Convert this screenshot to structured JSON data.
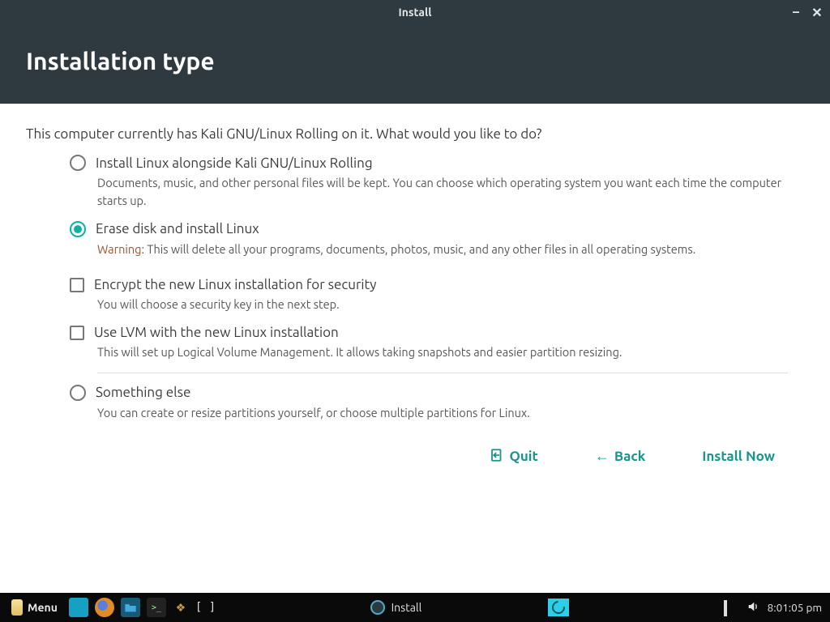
{
  "window": {
    "title": "Install"
  },
  "header": {
    "title": "Installation type"
  },
  "intro": "This computer currently has Kali GNU/Linux Rolling on it. What would you like to do?",
  "options": {
    "alongside": {
      "label": "Install Linux alongside Kali GNU/Linux Rolling",
      "desc": "Documents, music, and other personal files will be kept. You can choose which operating system you want each time the computer starts up."
    },
    "erase": {
      "label": "Erase disk and install Linux",
      "warn_label": "Warning:",
      "desc": " This will delete all your programs, documents, photos, music, and any other files in all operating systems."
    },
    "encrypt": {
      "label": "Encrypt the new Linux installation for security",
      "desc": "You will choose a security key in the next step."
    },
    "lvm": {
      "label": "Use LVM with the new Linux installation",
      "desc": "This will set up Logical Volume Management. It allows taking snapshots and easier partition resizing."
    },
    "something": {
      "label": "Something else",
      "desc": "You can create or resize partitions yourself, or choose multiple partitions for Linux."
    }
  },
  "buttons": {
    "quit": "Quit",
    "back": "Back",
    "install": "Install Now"
  },
  "taskbar": {
    "menu": "Menu",
    "task_label": "Install",
    "brackets": "[ ]",
    "clock": "8:01:05 pm"
  }
}
